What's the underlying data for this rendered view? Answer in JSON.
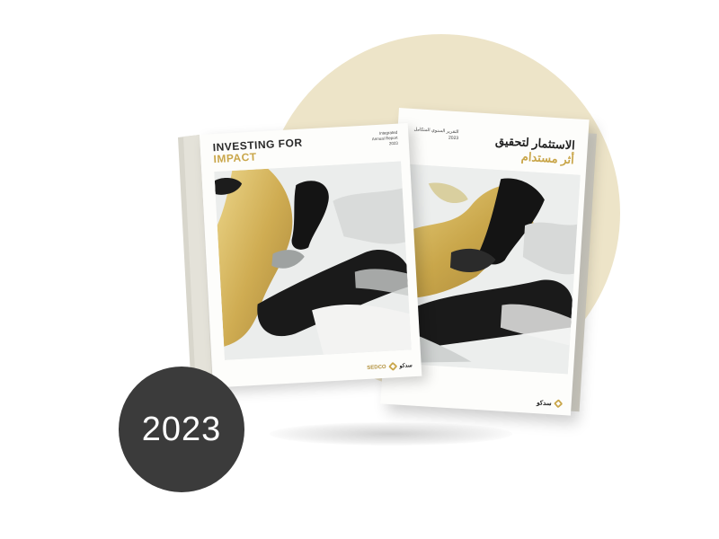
{
  "badge": {
    "year": "2023"
  },
  "colors": {
    "circle_bg": "#ede4c8",
    "gold": "#c9a64a",
    "badge_bg": "#3b3b3b",
    "ink": "#222222"
  },
  "book_en": {
    "title_line1": "INVESTING FOR",
    "title_line2": "IMPACT",
    "label_lines": [
      "Integrated",
      "Annual Report",
      "2023"
    ],
    "brand_en": "SEDCO",
    "brand_ar": "سدكو"
  },
  "book_ar": {
    "title_line1": "الاستثمار لتحقيق",
    "title_line2": "أثر مستدام",
    "label_lines": [
      "التقرير السنوي المتكامل",
      "2023"
    ],
    "brand_ar": "سدكو"
  }
}
